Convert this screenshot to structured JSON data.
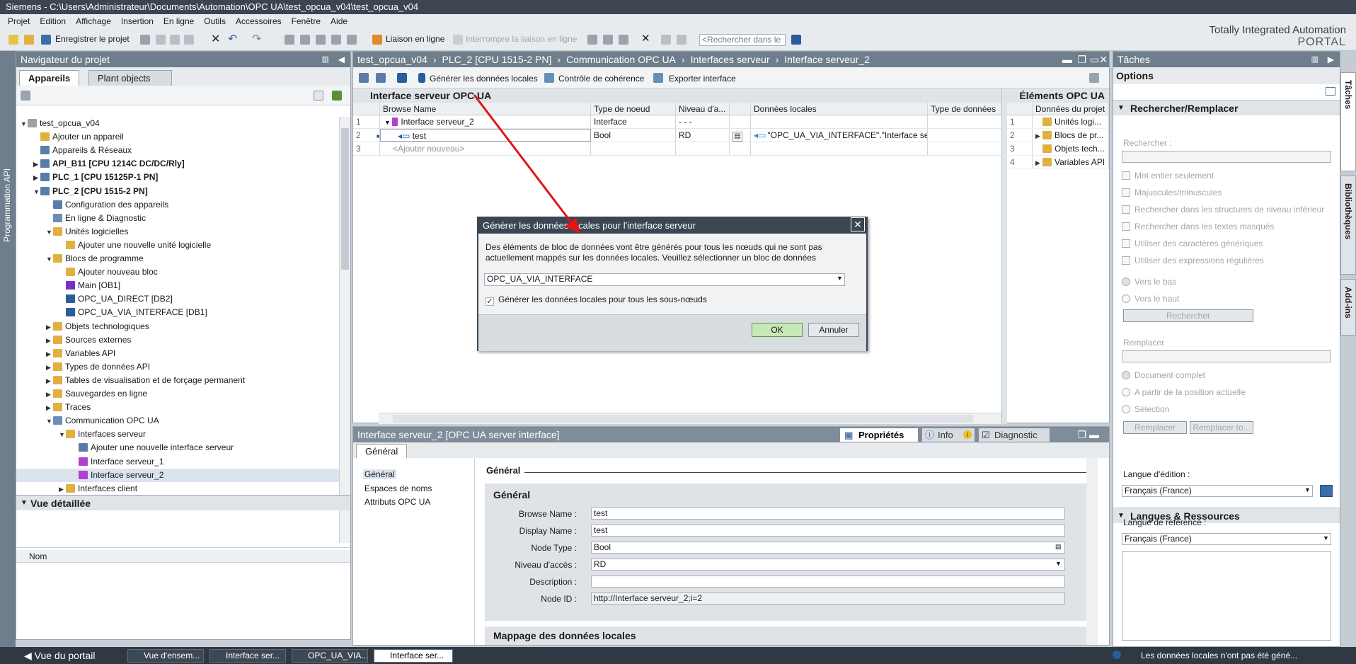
{
  "window": {
    "title": "Siemens  -  C:\\Users\\Administrateur\\Documents\\Automation\\OPC UA\\test_opcua_v04\\test_opcua_v04"
  },
  "menu": [
    "Projet",
    "Edition",
    "Affichage",
    "Insertion",
    "En ligne",
    "Outils",
    "Accessoires",
    "Fenêtre",
    "Aide"
  ],
  "toolbar": {
    "save_label": "Enregistrer le projet",
    "online_label": "Liaison en ligne",
    "offline_label": "Interrompre la liaison en ligne",
    "search_placeholder": "<Rechercher dans le"
  },
  "brand": {
    "line1": "Totally Integrated Automation",
    "line2": "PORTAL"
  },
  "sidetabs": {
    "left": "Programmation API",
    "right1": "Tâches",
    "right2": "Bibliothèques",
    "right3": "Add-ins"
  },
  "navigator": {
    "title": "Navigateur du projet",
    "tab_active": "Appareils",
    "tab_other": "Plant objects",
    "tree": [
      {
        "label": "test_opcua_v04"
      },
      {
        "label": "Ajouter un appareil"
      },
      {
        "label": "Appareils & Réseaux"
      },
      {
        "label": "API_B11 [CPU 1214C DC/DC/Rly]"
      },
      {
        "label": "PLC_1 [CPU 15125P-1 PN]"
      },
      {
        "label": "PLC_2 [CPU 1515-2 PN]"
      },
      {
        "label": "Configuration des appareils"
      },
      {
        "label": "En ligne & Diagnostic"
      },
      {
        "label": "Unités logicielles"
      },
      {
        "label": "Ajouter une nouvelle unité logicielle"
      },
      {
        "label": "Blocs de programme"
      },
      {
        "label": "Ajouter nouveau bloc"
      },
      {
        "label": "Main [OB1]"
      },
      {
        "label": "OPC_UA_DIRECT [DB2]"
      },
      {
        "label": "OPC_UA_VIA_INTERFACE [DB1]"
      },
      {
        "label": "Objets technologiques"
      },
      {
        "label": "Sources externes"
      },
      {
        "label": "Variables API"
      },
      {
        "label": "Types de données API"
      },
      {
        "label": "Tables de visualisation et de forçage permanent"
      },
      {
        "label": "Sauvegardes en ligne"
      },
      {
        "label": "Traces"
      },
      {
        "label": "Communication OPC UA"
      },
      {
        "label": "Interfaces serveur"
      },
      {
        "label": "Ajouter une nouvelle interface serveur"
      },
      {
        "label": "Interface serveur_1"
      },
      {
        "label": "Interface serveur_2"
      },
      {
        "label": "Interfaces client"
      }
    ],
    "detail_title": "Vue détaillée",
    "detail_col": "Nom"
  },
  "editor": {
    "breadcrumb": [
      "test_opcua_v04",
      "PLC_2 [CPU 1515-2 PN]",
      "Communication OPC UA",
      "Interfaces serveur",
      "Interface serveur_2"
    ],
    "btn_generate": "Générer les données locales",
    "btn_check": "Contrôle de cohérence",
    "btn_export": "Exporter interface",
    "left_title": "Interface serveur OPC UA",
    "right_title": "Éléments OPC UA",
    "columns": [
      "Browse Name",
      "Type de noeud",
      "Niveau d'a...",
      "Données locales",
      "Type de données"
    ],
    "rows": [
      {
        "n": "1",
        "name": "Interface serveur_2",
        "type": "Interface",
        "level": "- - -",
        "local": "",
        "dtype": ""
      },
      {
        "n": "2",
        "name": "test",
        "type": "Bool",
        "level": "RD",
        "local": "\"OPC_UA_VIA_INTERFACE\".\"Interface serv...",
        "dtype": ""
      },
      {
        "n": "3",
        "name": "<Ajouter nouveau>",
        "type": "",
        "level": "",
        "local": "",
        "dtype": ""
      }
    ],
    "right_col": "Données du projet",
    "right_rows": [
      {
        "n": "1",
        "label": "Unités logi..."
      },
      {
        "n": "2",
        "label": "Blocs de pr..."
      },
      {
        "n": "3",
        "label": "Objets tech..."
      },
      {
        "n": "4",
        "label": "Variables API"
      }
    ]
  },
  "dialog": {
    "title": "Générer les données locales pour l'interface serveur",
    "message": "Des éléments de bloc de données vont être générés pour tous les nœuds qui ne sont pas actuellement mappés sur les données locales. Veuillez sélectionner un bloc de données",
    "select_value": "OPC_UA_VIA_INTERFACE",
    "checkbox_label": "Générer les données locales pour tous les sous-nœuds",
    "ok": "OK",
    "cancel": "Annuler"
  },
  "inspector": {
    "title": "Interface serveur_2 [OPC UA server interface]",
    "tab_props": "Propriétés",
    "tab_info": "Info",
    "tab_diag": "Diagnostic",
    "main_tab": "Général",
    "nav": [
      "Général",
      "Espaces de noms",
      "Attributs OPC UA"
    ],
    "section_title": "Général",
    "group_title": "Général",
    "fields": [
      {
        "label": "Browse Name :",
        "value": "test"
      },
      {
        "label": "Display Name :",
        "value": "test"
      },
      {
        "label": "Node Type :",
        "value": "Bool"
      },
      {
        "label": "Niveau d'accès :",
        "value": "RD"
      },
      {
        "label": "Description :",
        "value": ""
      },
      {
        "label": "Node ID :",
        "value": "http://Interface serveur_2;i=2"
      }
    ],
    "next_section": "Mappage des données locales"
  },
  "tasks": {
    "title": "Tâches",
    "options": "Options",
    "search_section": "Rechercher/Remplacer",
    "search_label": "Rechercher :",
    "checks": [
      "Mot entier seulement",
      "Majuscules/minuscules",
      "Rechercher dans les structures de niveau inférieur",
      "Rechercher dans les textes masqués",
      "Utiliser des caractères génériques",
      "Utiliser des expressions régulières"
    ],
    "dir": [
      "Vers le bas",
      "Vers le haut"
    ],
    "search_btn": "Rechercher",
    "replace_label": "Remplacer",
    "scope": [
      "Document complet",
      "A partir de la position actuelle",
      "Sélection"
    ],
    "replace_btn": "Remplacer",
    "replace_to_btn": "Remplacer to...",
    "lang_section": "Langues & Ressources",
    "edit_lang_label": "Langue d'édition :",
    "edit_lang": "Français (France)",
    "ref_lang_label": "Langue de référence :",
    "ref_lang": "Français (France)"
  },
  "statusbar": {
    "portal": "Vue du portail",
    "tabs": [
      "Vue d'ensem...",
      "Interface ser...",
      "OPC_UA_VIA...",
      "Interface ser..."
    ],
    "message": "Les données locales n'ont pas été géné..."
  }
}
